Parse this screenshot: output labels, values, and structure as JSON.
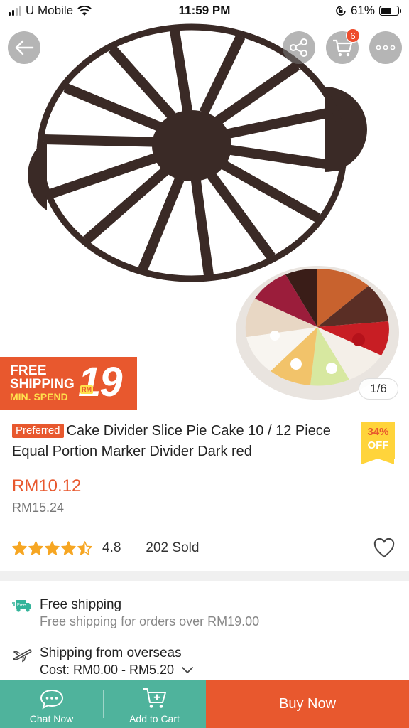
{
  "status_bar": {
    "carrier": "U Mobile",
    "time": "11:59 PM",
    "battery": "61%",
    "battery_level": 0.61
  },
  "header": {
    "cart_count": "6"
  },
  "gallery": {
    "counter": "1/6"
  },
  "promo": {
    "line1": "FREE",
    "line2": "SHIPPING",
    "line3": "MIN. SPEND",
    "currency": "RM",
    "amount": "19"
  },
  "product": {
    "badge": "Preferred",
    "title": "Cake Divider Slice Pie Cake 10 / 12 Piece Equal Portion Marker Divider Dark red",
    "discount_pct": "34%",
    "discount_label": "OFF",
    "price": "RM10.12",
    "original_price": "RM15.24",
    "rating": "4.8",
    "rating_stars": 4.5,
    "sold": "202 Sold"
  },
  "shipping": {
    "free_title": "Free shipping",
    "free_sub": "Free shipping for orders over RM19.00",
    "free_icon_text": "Free",
    "from_prefix": "Shipping from",
    "from_location": "overseas",
    "cost": "Cost: RM0.00 - RM5.20"
  },
  "bottom_bar": {
    "chat": "Chat Now",
    "add_cart": "Add to Cart",
    "buy": "Buy Now"
  },
  "colors": {
    "accent": "#e8582e",
    "green": "#4fb39c",
    "star": "#f6a623",
    "divider_product": "#3a2a26"
  }
}
